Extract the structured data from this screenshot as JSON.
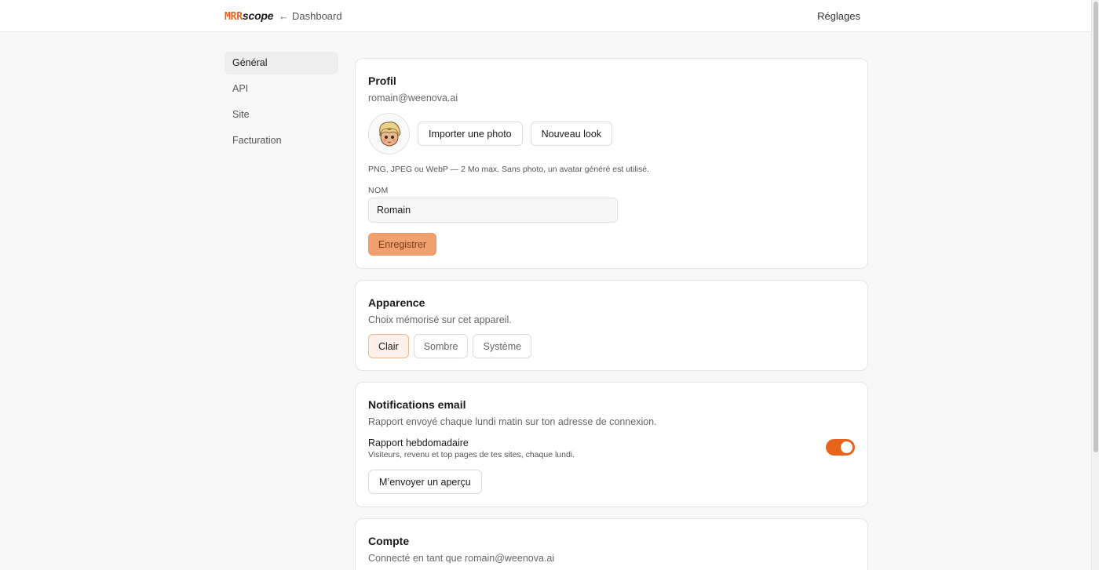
{
  "header": {
    "logo_mrr": "MRR",
    "logo_scope": "scope",
    "back_arrow": "←",
    "back_label": "Dashboard",
    "page_label": "Réglages"
  },
  "sidebar": {
    "items": [
      {
        "label": "Général",
        "active": true
      },
      {
        "label": "API",
        "active": false
      },
      {
        "label": "Site",
        "active": false
      },
      {
        "label": "Facturation",
        "active": false
      }
    ]
  },
  "profil": {
    "title": "Profil",
    "email": "romain@weenova.ai",
    "import_button": "Importer une photo",
    "new_look_button": "Nouveau look",
    "hint": "PNG, JPEG ou WebP — 2 Mo max. Sans photo, un avatar généré est utilisé.",
    "name_label": "NOM",
    "name_value": "Romain",
    "save_button": "Enregistrer"
  },
  "apparence": {
    "title": "Apparence",
    "subtitle": "Choix mémorisé sur cet appareil.",
    "options": [
      {
        "label": "Clair",
        "active": true
      },
      {
        "label": "Sombre",
        "active": false
      },
      {
        "label": "Système",
        "active": false
      }
    ]
  },
  "notifications": {
    "title": "Notifications email",
    "subtitle": "Rapport envoyé chaque lundi matin sur ton adresse de connexion.",
    "weekly_title": "Rapport hebdomadaire",
    "weekly_sub": "Visiteurs, revenu et top pages de tes sites, chaque lundi.",
    "weekly_enabled": true,
    "preview_button": "M’envoyer un aperçu"
  },
  "compte": {
    "title": "Compte",
    "subtitle": "Connecté en tant que romain@weenova.ai"
  },
  "colors": {
    "accent": "#e8641b",
    "save_bg": "#f0a06e"
  }
}
